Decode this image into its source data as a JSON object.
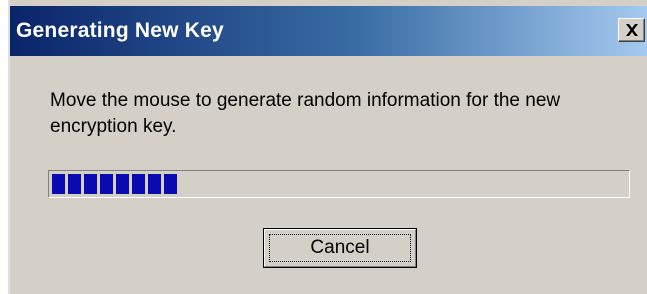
{
  "window": {
    "title": "Generating New Key",
    "close_icon": "close-icon",
    "titlebar_colors": [
      "#0a246a",
      "#3a6ea5",
      "#a6caf0"
    ]
  },
  "message": {
    "text": "Move the mouse to generate random information for the new encryption key."
  },
  "progress": {
    "fraction": 0.22,
    "blocks_filled": 8,
    "color": "#0a0ab4"
  },
  "buttons": {
    "cancel_label": "Cancel"
  }
}
